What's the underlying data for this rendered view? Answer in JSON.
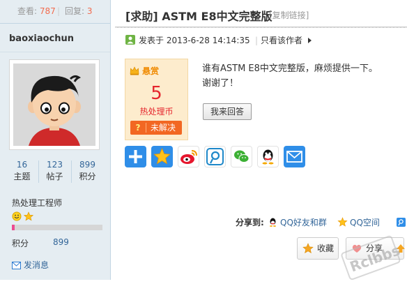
{
  "left": {
    "views_label": "查看:",
    "views_value": "787",
    "separator": "|",
    "replies_label": "回复:",
    "replies_value": "3",
    "username": "baoxiaochun",
    "stats": [
      {
        "value": "16",
        "label": "主题"
      },
      {
        "value": "123",
        "label": "帖子"
      },
      {
        "value": "899",
        "label": "积分"
      }
    ],
    "user_title": "热处理工程师",
    "progress_fraction": 0.03,
    "points_label": "积分",
    "points_value": "899",
    "send_message": "发消息"
  },
  "post": {
    "title": "[求助] ASTM E8中文完整版",
    "copy_link": "[复制链接]",
    "posted_at": "发表于 2013-6-28 14:14:35",
    "pipe": "|",
    "only_author": "只看该作者",
    "reward": {
      "header": "悬赏",
      "amount": "5",
      "unit": "热处理币",
      "status_icon": "?",
      "status": "未解决"
    },
    "body_line1": "谁有ASTM E8中文完整版，麻烦提供一下。",
    "body_line2": "谢谢了！",
    "answer_button": "我来回答",
    "share_icons": [
      "plus-icon",
      "qzone-star-icon",
      "weibo-icon",
      "tencent-weibo-icon",
      "wechat-icon",
      "qq-icon",
      "email-icon"
    ]
  },
  "share_to": {
    "label": "分享到:",
    "items": [
      "QQ好友和群",
      "QQ空间"
    ]
  },
  "actions": {
    "favorite": "收藏",
    "like": "分享"
  },
  "watermark": "Rclbbs",
  "colors": {
    "left_bg": "#e5edf2",
    "link": "#336699",
    "accent_red": "#f26c4f",
    "reward_orange": "#f26722"
  }
}
